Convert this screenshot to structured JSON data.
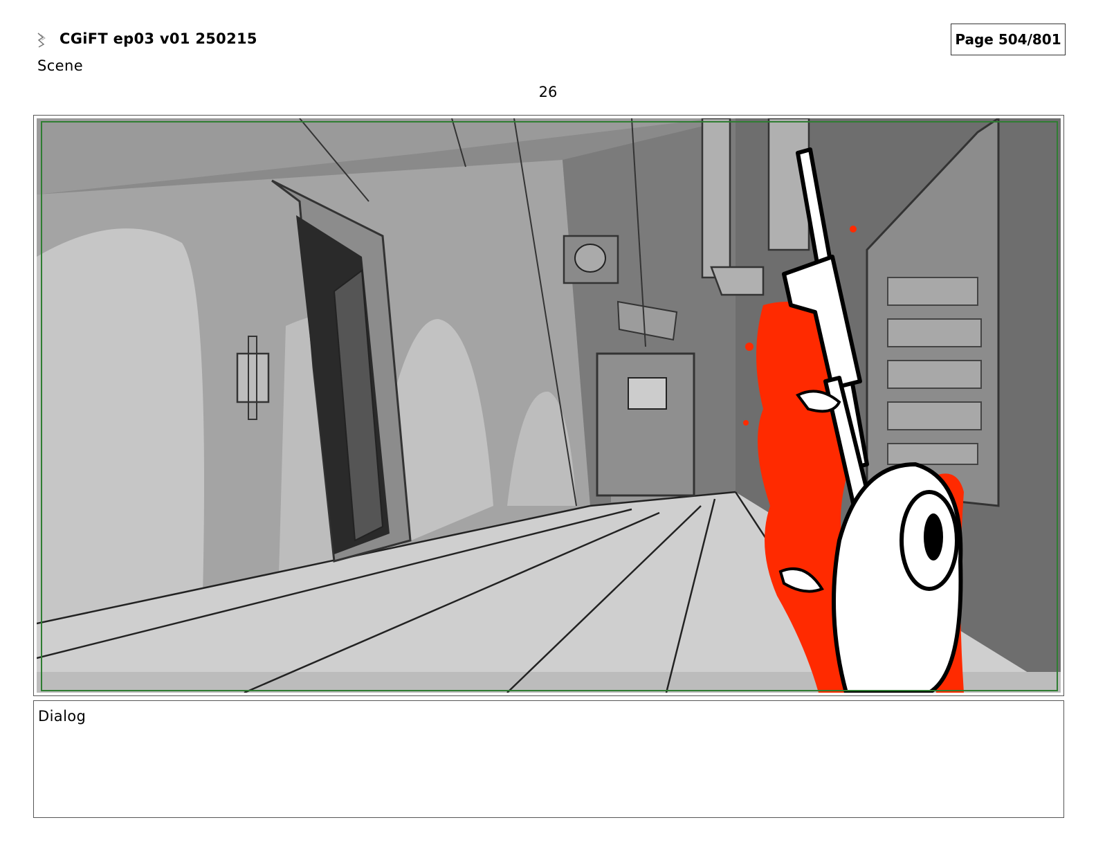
{
  "header": {
    "title": "CGiFT ep03 v01 250215",
    "page": "Page 504/801",
    "scene_label": "Scene",
    "panel_number": "26"
  },
  "panel": {
    "content": "storyboard-sketch",
    "colors": {
      "background": "#a9a9a9",
      "accent": "#ff2a00",
      "safe_frame": "#2f7d32"
    }
  },
  "dialog": {
    "label": "Dialog",
    "text": ""
  }
}
